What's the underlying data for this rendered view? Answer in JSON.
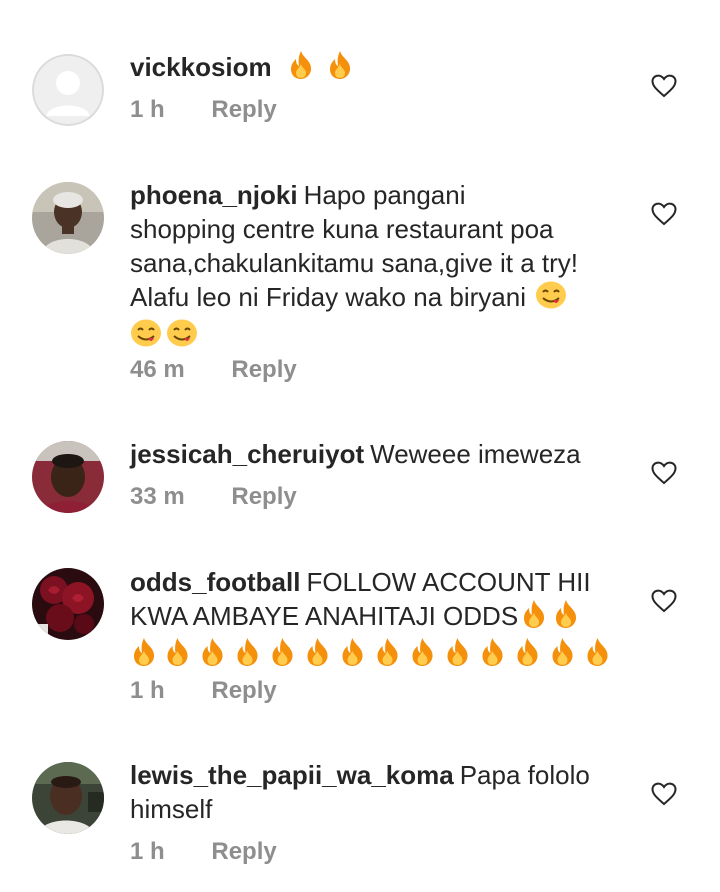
{
  "comments": [
    {
      "username": "vickkosiom",
      "text": "",
      "emojis": [
        "fire-emoji",
        "fire-emoji"
      ],
      "time": "1 h",
      "reply": "Reply"
    },
    {
      "username": "phoena_njoki",
      "text_lines": [
        "Hapo pangani",
        "shopping centre kuna restaurant poa",
        "sana,chakulankitamu sana,give it a try!",
        "Alafu leo ni Friday wako na biryani"
      ],
      "emojis": [
        "yum-face-emoji",
        "yum-face-emoji",
        "yum-face-emoji"
      ],
      "time": "46 m",
      "reply": "Reply"
    },
    {
      "username": "jessicah_cheruiyot",
      "text": "Weweee imeweza",
      "time": "33 m",
      "reply": "Reply"
    },
    {
      "username": "odds_football",
      "text_lines": [
        "FOLLOW ACCOUNT HII",
        "KWA AMBAYE ANAHITAJI ODDS"
      ],
      "emojis": [
        "fire-emoji",
        "fire-emoji",
        "fire-emoji",
        "fire-emoji",
        "fire-emoji",
        "fire-emoji",
        "fire-emoji",
        "fire-emoji",
        "fire-emoji",
        "fire-emoji",
        "fire-emoji",
        "fire-emoji",
        "fire-emoji",
        "fire-emoji",
        "fire-emoji",
        "fire-emoji"
      ],
      "time": "1 h",
      "reply": "Reply"
    },
    {
      "username": "lewis_the_papii_wa_koma",
      "text_lines": [
        "Papa fololo",
        "himself"
      ],
      "time": "1 h",
      "reply": "Reply"
    }
  ],
  "icons": {
    "like": "heart-outline-icon",
    "default_avatar": "default-avatar-icon"
  },
  "colors": {
    "text": "#262626",
    "meta": "#8e8e8e",
    "fire_outer": "#f4900c",
    "fire_inner": "#ffcc4d"
  }
}
